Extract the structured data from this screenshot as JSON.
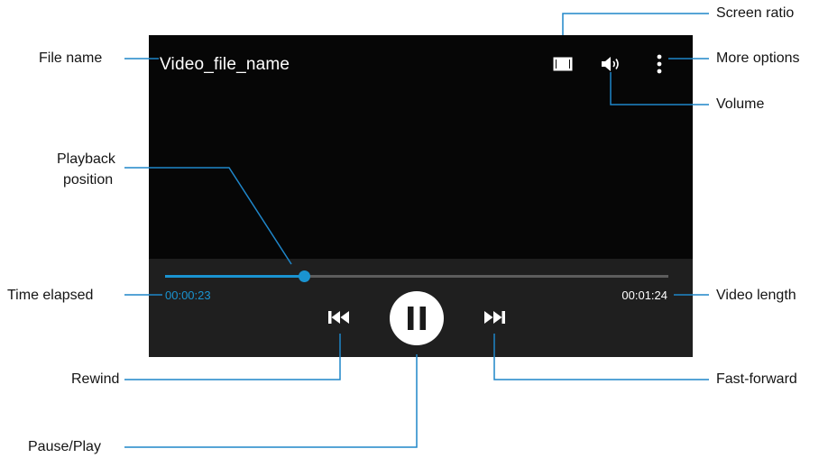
{
  "player": {
    "file_name": "Video_file_name",
    "time_elapsed": "00:00:23",
    "time_total": "00:01:24",
    "progress_fraction": 0.276,
    "accent_color": "#1a93d0",
    "icons": {
      "screen_ratio": "screen-ratio-icon",
      "volume": "speaker-icon",
      "more_options": "vertical-dots-icon",
      "rewind": "rewind-icon",
      "pause": "pause-icon",
      "fast_forward": "fast-forward-icon"
    }
  },
  "callouts": {
    "file_name": "File name",
    "screen_ratio": "Screen ratio",
    "more_options": "More options",
    "volume": "Volume",
    "playback_position_line1": "Playback",
    "playback_position_line2": "position",
    "time_elapsed": "Time elapsed",
    "video_length": "Video length",
    "rewind": "Rewind",
    "fast_forward": "Fast-forward",
    "pause_play": "Pause/Play"
  },
  "leader_color": "#1f86c9"
}
